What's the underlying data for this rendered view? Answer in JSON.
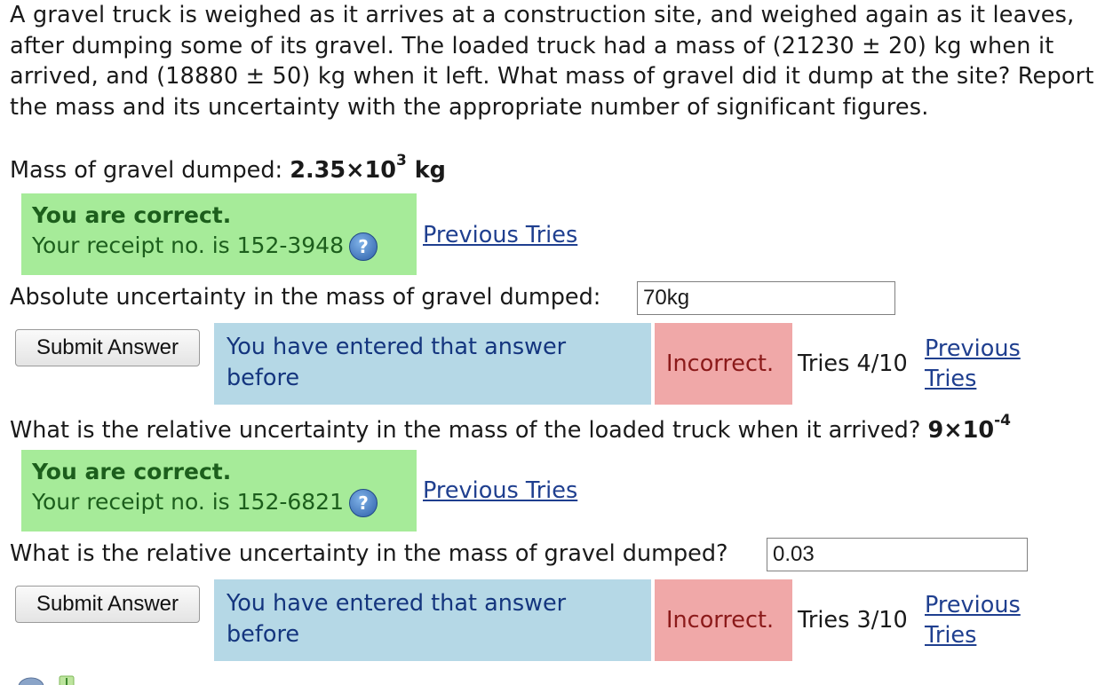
{
  "problem_text": "A gravel truck is weighed as it arrives at a construction site, and weighed again as it leaves, after dumping some of its gravel. The loaded truck had a mass of (21230 ± 20) kg when it arrived, and (18880 ± 50) kg when it left. What mass of gravel did it dump at the site? Report the mass and its uncertainty with the appropriate number of significant figures.",
  "q1": {
    "label": "Mass of gravel dumped:",
    "answer_mantissa": "2.35×10",
    "answer_exp": "3",
    "answer_unit": " kg",
    "correct_title": "You are correct.",
    "receipt": "Your receipt no. is 152-3948",
    "previous_tries": "Previous Tries"
  },
  "q2": {
    "label": "Absolute uncertainty in the mass of gravel dumped:",
    "input_value": "70kg",
    "submit_label": "Submit Answer",
    "entered_msg": "You have entered that answer before",
    "incorrect": "Incorrect.",
    "tries": "Tries 4/10",
    "previous_tries_1": "Previous",
    "previous_tries_2": "Tries"
  },
  "q3": {
    "label": "What is the relative uncertainty in the mass of the loaded truck when it arrived?",
    "answer_mantissa": "9×10",
    "answer_exp": "-4",
    "correct_title": "You are correct.",
    "receipt": "Your receipt no. is 152-6821",
    "previous_tries": "Previous Tries"
  },
  "q4": {
    "label": "What is the relative uncertainty in the mass of gravel dumped?",
    "input_value": "0.03",
    "submit_label": "Submit Answer",
    "entered_msg": "You have entered that answer before",
    "incorrect": "Incorrect.",
    "tries": "Tries 3/10",
    "previous_tries_1": "Previous",
    "previous_tries_2": "Tries"
  },
  "icons": [
    "help-icon",
    "toolbar-icons"
  ]
}
